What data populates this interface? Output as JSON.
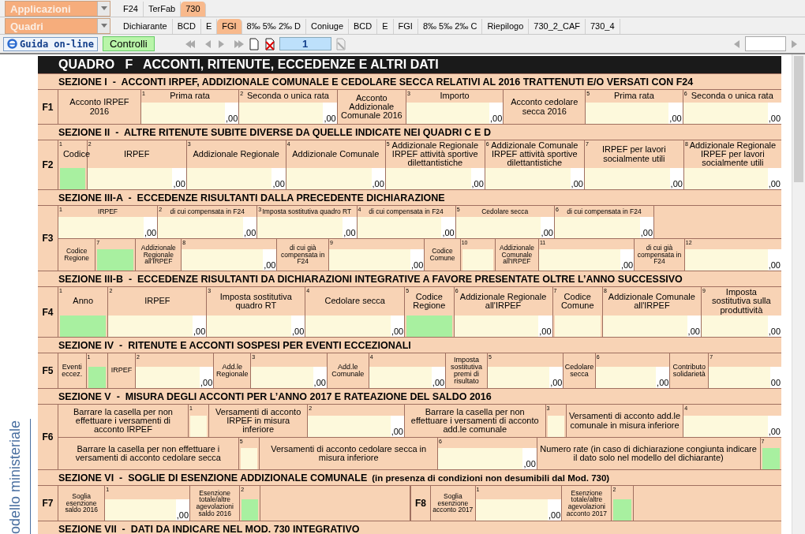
{
  "selectors": [
    {
      "label": "Applicazioni",
      "tabs": [
        {
          "label": "F24",
          "selected": false
        },
        {
          "label": "TerFab",
          "selected": false
        },
        {
          "label": "730",
          "selected": true
        }
      ]
    },
    {
      "label": "Quadri",
      "tabs": [
        {
          "label": "Dichiarante",
          "selected": false
        },
        {
          "label": "BCD",
          "selected": false
        },
        {
          "label": "E",
          "selected": false
        },
        {
          "label": "FGI",
          "selected": true
        },
        {
          "label": "8‰  5‰  2‰ D",
          "selected": false
        },
        {
          "label": "Coniuge",
          "selected": false
        },
        {
          "label": "BCD",
          "selected": false
        },
        {
          "label": "E",
          "selected": false
        },
        {
          "label": "FGI",
          "selected": false
        },
        {
          "label": "8‰  5‰  2‰ C",
          "selected": false
        },
        {
          "label": "Riepilogo",
          "selected": false
        },
        {
          "label": "730_2_CAF",
          "selected": false
        },
        {
          "label": "730_4",
          "selected": false
        }
      ]
    }
  ],
  "toolbar": {
    "help": "Guida on-line",
    "checks": "Controlli",
    "page": "1"
  },
  "side_label": "odello ministeriale",
  "form": {
    "title": "QUADRO   F   ACCONTI, RITENUTE, ECCEDENZE E ALTRI DATI",
    "sections": [
      {
        "title": "SEZIONE I  -  ACCONTI IRPEF, ADDIZIONALE COMUNALE E CEDOLARE SECCA RELATIVI AL 2016 TRATTENUTI E/O VERSATI CON F24",
        "rows": [
          {
            "code": "F1",
            "lines": [
              [
                {
                  "kind": "label",
                  "text": "Acconto IRPEF 2016"
                },
                {
                  "kind": "amount",
                  "num": "1",
                  "caption": "Prima rata",
                  "suffix": ",00"
                },
                {
                  "kind": "amount",
                  "num": "2",
                  "caption": "Seconda o unica rata",
                  "suffix": ",00"
                },
                {
                  "kind": "label",
                  "text": "Acconto Addizionale Comunale 2016"
                },
                {
                  "kind": "amount",
                  "num": "3",
                  "caption": "Importo",
                  "suffix": ",00"
                },
                {
                  "kind": "label",
                  "text": "Acconto cedolare secca 2016"
                },
                {
                  "kind": "amount",
                  "num": "5",
                  "caption": "Prima rata",
                  "suffix": ",00"
                },
                {
                  "kind": "amount",
                  "num": "6",
                  "caption": "Seconda o unica rata",
                  "suffix": ",00"
                }
              ]
            ]
          }
        ]
      },
      {
        "title": "SEZIONE II  -  ALTRE RITENUTE SUBITE DIVERSE DA QUELLE INDICATE NEI QUADRI C E D",
        "rows": [
          {
            "code": "F2",
            "lines": [
              [
                {
                  "kind": "box",
                  "num": "1",
                  "caption": "Codice",
                  "color": "#a8f0a0"
                },
                {
                  "kind": "amount",
                  "num": "2",
                  "caption": "IRPEF",
                  "suffix": ",00"
                },
                {
                  "kind": "amount",
                  "num": "3",
                  "caption": "Addizionale Regionale",
                  "suffix": ",00"
                },
                {
                  "kind": "amount",
                  "num": "4",
                  "caption": "Addizionale Comunale",
                  "suffix": ",00"
                },
                {
                  "kind": "amount",
                  "num": "5",
                  "caption": "Addizionale Regionale IRPEF attività sportive dilettantistiche",
                  "suffix": ",00"
                },
                {
                  "kind": "amount",
                  "num": "6",
                  "caption": "Addizionale Comunale IRPEF attività sportive dilettantistiche",
                  "suffix": ",00"
                },
                {
                  "kind": "amount",
                  "num": "7",
                  "caption": "IRPEF per lavori socialmente utili",
                  "suffix": ",00"
                },
                {
                  "kind": "amount",
                  "num": "8",
                  "caption": "Addizionale Regionale IRPEF per lavori socialmente utili",
                  "suffix": ",00"
                }
              ]
            ]
          }
        ]
      },
      {
        "title": "SEZIONE III-A  -  ECCEDENZE RISULTANTI DALLA PRECEDENTE DICHIARAZIONE",
        "rows": [
          {
            "code": "F3",
            "lines": [
              [
                {
                  "kind": "amount",
                  "num": "1",
                  "caption": "IRPEF",
                  "suffix": ",00"
                },
                {
                  "kind": "amount",
                  "num": "2",
                  "caption": "di cui compensata in F24",
                  "suffix": ",00"
                },
                {
                  "kind": "amount",
                  "num": "3",
                  "caption": "Imposta sostitutiva quadro RT",
                  "suffix": ",00"
                },
                {
                  "kind": "amount",
                  "num": "4",
                  "caption": "di cui compensata in F24",
                  "suffix": ",00"
                },
                {
                  "kind": "amount",
                  "num": "5",
                  "caption": "Cedolare secca",
                  "suffix": ",00"
                },
                {
                  "kind": "amount",
                  "num": "6",
                  "caption": "di cui compensata in F24",
                  "suffix": ",00"
                },
                {
                  "kind": "blank"
                }
              ],
              [
                {
                  "kind": "label",
                  "text": "Codice Regione"
                },
                {
                  "kind": "box",
                  "num": "7",
                  "color": "#a8f0a0"
                },
                {
                  "kind": "label",
                  "text": "Addizionale Regionale all'IRPEF"
                },
                {
                  "kind": "amount",
                  "num": "8",
                  "suffix": ",00"
                },
                {
                  "kind": "label",
                  "text": "di cui già compensata in F24"
                },
                {
                  "kind": "amount",
                  "num": "9",
                  "suffix": ",00"
                },
                {
                  "kind": "label",
                  "text": "Codice Comune"
                },
                {
                  "kind": "box",
                  "num": "10",
                  "color": "#fdf9dc"
                },
                {
                  "kind": "label",
                  "text": "Addizionale Comunale all'IRPEF"
                },
                {
                  "kind": "amount",
                  "num": "11",
                  "suffix": ",00"
                },
                {
                  "kind": "label",
                  "text": "di cui già compensata in F24"
                },
                {
                  "kind": "amount",
                  "num": "12",
                  "suffix": ",00"
                }
              ]
            ]
          }
        ]
      },
      {
        "title": "SEZIONE III-B  -  ECCEDENZE RISULTANTI DA DICHIARAZIONI INTEGRATIVE A FAVORE PRESENTATE OLTRE L’ANNO SUCCESSIVO",
        "rows": [
          {
            "code": "F4",
            "lines": [
              [
                {
                  "kind": "box",
                  "num": "1",
                  "caption": "Anno",
                  "color": "#a8f0a0"
                },
                {
                  "kind": "amount",
                  "num": "2",
                  "caption": "IRPEF",
                  "suffix": ",00"
                },
                {
                  "kind": "amount",
                  "num": "3",
                  "caption": "Imposta sostitutiva quadro RT",
                  "suffix": ",00"
                },
                {
                  "kind": "amount",
                  "num": "4",
                  "caption": "Cedolare secca",
                  "suffix": ",00"
                },
                {
                  "kind": "box",
                  "num": "5",
                  "caption": "Codice Regione",
                  "color": "#a8f0a0"
                },
                {
                  "kind": "amount",
                  "num": "6",
                  "caption": "Addizionale Regionale all'IRPEF",
                  "suffix": ",00"
                },
                {
                  "kind": "box",
                  "num": "7",
                  "caption": "Codice Comune",
                  "color": "#fdf9dc"
                },
                {
                  "kind": "amount",
                  "num": "8",
                  "caption": "Addizionale Comunale all'IRPEF",
                  "suffix": ",00"
                },
                {
                  "kind": "amount",
                  "num": "9",
                  "caption": "Imposta sostitutiva sulla produttività",
                  "suffix": ",00"
                }
              ]
            ]
          }
        ]
      },
      {
        "title": "SEZIONE IV  -  RITENUTE E ACCONTI SOSPESI PER EVENTI ECCEZIONALI",
        "rows": [
          {
            "code": "F5",
            "lines": [
              [
                {
                  "kind": "label",
                  "text": "Eventi eccez."
                },
                {
                  "kind": "box",
                  "num": "1",
                  "color": "#a8f0a0"
                },
                {
                  "kind": "label",
                  "text": "IRPEF"
                },
                {
                  "kind": "amount",
                  "num": "2",
                  "suffix": ",00"
                },
                {
                  "kind": "label",
                  "text": "Add.le Regionale"
                },
                {
                  "kind": "amount",
                  "num": "3",
                  "suffix": ",00"
                },
                {
                  "kind": "label",
                  "text": "Add.le Comunale"
                },
                {
                  "kind": "amount",
                  "num": "4",
                  "suffix": ",00"
                },
                {
                  "kind": "label",
                  "text": "Imposta sostitutiva premi di risultato"
                },
                {
                  "kind": "amount",
                  "num": "5",
                  "suffix": ",00"
                },
                {
                  "kind": "label",
                  "text": "Cedolare secca"
                },
                {
                  "kind": "amount",
                  "num": "6",
                  "suffix": ",00"
                },
                {
                  "kind": "label",
                  "text": "Contributo solidarietà"
                },
                {
                  "kind": "amount",
                  "num": "7",
                  "suffix": "00"
                }
              ]
            ]
          }
        ]
      },
      {
        "title": "SEZIONE V  -  MISURA DEGLI ACCONTI PER L’ANNO 2017 E RATEAZIONE DEL SALDO 2016",
        "rows": [
          {
            "code": "F6",
            "lines": [
              [
                {
                  "kind": "label",
                  "text": "Barrare la casella per non effettuare i versamenti di acconto IRPEF"
                },
                {
                  "kind": "box",
                  "num": "1",
                  "color": "#fdf9dc"
                },
                {
                  "kind": "label",
                  "text": "Versamenti di acconto IRPEF in misura inferiore"
                },
                {
                  "kind": "amount",
                  "num": "2",
                  "suffix": ",00"
                },
                {
                  "kind": "label",
                  "text": "Barrare la casella per non effettuare i versamenti di acconto add.le comunale"
                },
                {
                  "kind": "box",
                  "num": "3",
                  "color": "#fdf9dc"
                },
                {
                  "kind": "label",
                  "text": "Versamenti di acconto add.le comunale in misura inferiore"
                },
                {
                  "kind": "amount",
                  "num": "4",
                  "suffix": ",00"
                }
              ],
              [
                {
                  "kind": "label",
                  "text": "Barrare la casella per non effettuare i versamenti di acconto cedolare secca"
                },
                {
                  "kind": "box",
                  "num": "5",
                  "color": "#fdf9dc"
                },
                {
                  "kind": "label",
                  "text": "Versamenti di acconto cedolare secca in misura inferiore"
                },
                {
                  "kind": "amount",
                  "num": "6",
                  "suffix": ",00"
                },
                {
                  "kind": "label",
                  "text": "Numero rate (in caso di dichiarazione congiunta indicare il dato solo nel modello del dichiarante)"
                },
                {
                  "kind": "box",
                  "num": "7",
                  "color": "#a8f0a0"
                }
              ]
            ]
          }
        ]
      },
      {
        "title": "SEZIONE VI  -  SOGLIE DI ESENZIONE ADDIZIONALE COMUNALE",
        "note": "(in presenza di condizioni non desumibili dal Mod. 730)",
        "rows": [
          {
            "code": "F7",
            "lines": [
              [
                {
                  "kind": "label",
                  "text": "Soglia esenzione saldo 2016"
                },
                {
                  "kind": "amount",
                  "num": "1",
                  "suffix": ",00"
                },
                {
                  "kind": "label",
                  "text": "Esenzione totale/altre agevolazioni saldo 2016"
                },
                {
                  "kind": "box",
                  "num": "2",
                  "color": "#a8f0a0"
                },
                {
                  "kind": "blank"
                },
                {
                  "kind": "code",
                  "text": "F8"
                },
                {
                  "kind": "label",
                  "text": "Soglia esenzione acconto 2017"
                },
                {
                  "kind": "amount",
                  "num": "1",
                  "suffix": ",00"
                },
                {
                  "kind": "label",
                  "text": "Esenzione totale/altre agevolazioni acconto 2017"
                },
                {
                  "kind": "box",
                  "num": "2",
                  "color": "#a8f0a0"
                },
                {
                  "kind": "blank"
                }
              ]
            ]
          }
        ]
      },
      {
        "title": "SEZIONE VII  -  DATI DA INDICARE NEL MOD. 730 INTEGRATIVO"
      }
    ]
  }
}
